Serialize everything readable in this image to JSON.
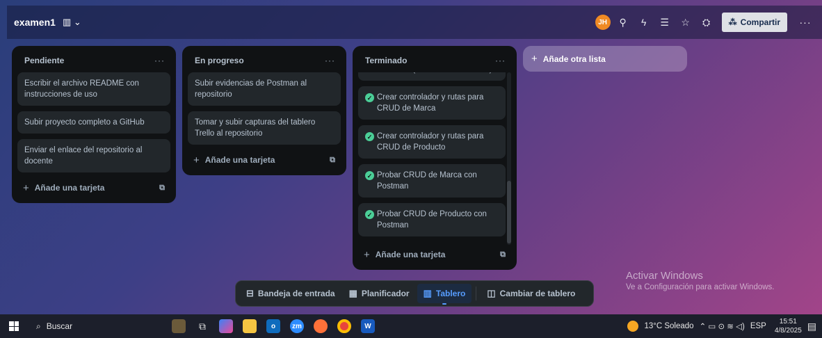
{
  "header": {
    "board_title": "examen1",
    "board_icon": "board-view-icon",
    "avatar_initials": "JH",
    "share_label": "Compartir",
    "more": "···"
  },
  "lists": [
    {
      "title": "Pendiente",
      "more": "···",
      "cards": [
        "Escribir el archivo README con instrucciones de uso",
        "Subir proyecto completo a GitHub",
        "Enviar el enlace del repositorio al docente"
      ],
      "add_card": "Añade una tarjeta"
    },
    {
      "title": "En progreso",
      "more": "···",
      "cards": [
        "Subir evidencias de Postman al repositorio",
        "Tomar y subir capturas del tablero Trello al repositorio"
      ],
      "add_card": "Añade una tarjeta"
    },
    {
      "title": "Terminado",
      "more": "···",
      "cards": [
        "Producto (con relación a Marca)",
        "Crear controlador y rutas para CRUD de Marca",
        "Crear controlador y rutas para CRUD de Producto",
        "Probar CRUD de Marca con Postman",
        "Probar CRUD de Producto con Postman"
      ],
      "add_card": "Añade una tarjeta"
    }
  ],
  "add_list": "Añade otra lista",
  "bottom_nav": {
    "inbox": "Bandeja de entrada",
    "planner": "Planificador",
    "board": "Tablero",
    "switch_board": "Cambiar de tablero",
    "active": "Tablero"
  },
  "watermark": {
    "line1": "Activar Windows",
    "line2": "Ve a Configuración para activar Windows."
  },
  "taskbar": {
    "search_label": "Buscar",
    "weather": "13°C Soleado",
    "language": "ESP",
    "time": "15:51",
    "date": "4/8/2025"
  },
  "colors": {
    "accent": "#579dff",
    "done_check": "#4bce97",
    "avatar": "#f08a24"
  }
}
